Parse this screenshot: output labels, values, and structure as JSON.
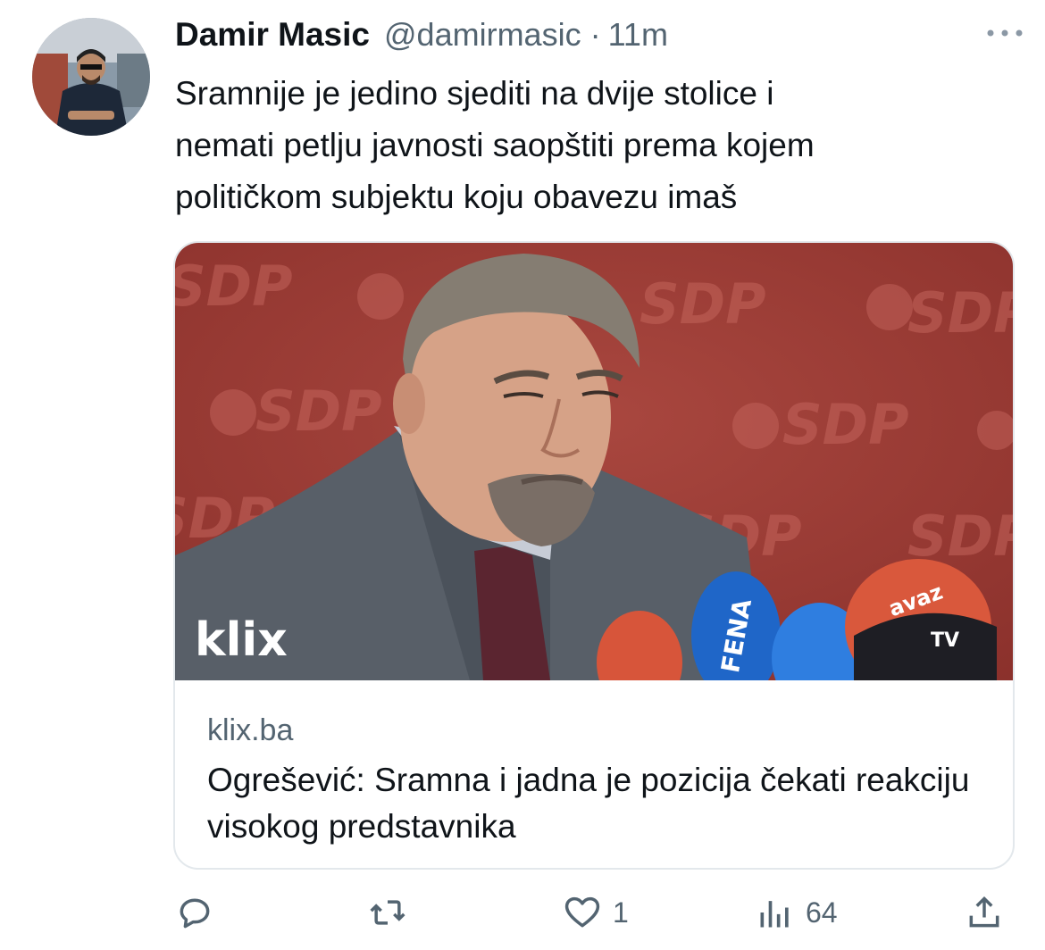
{
  "tweet": {
    "author_name": "Damir Masic",
    "author_handle": "@damirmasic",
    "separator": "·",
    "time": "11m",
    "text": "Sramnije je jedino sjediti na dvije stolice i\nnemati petlju javnosti saopštiti prema kojem\npolitičkom subjektu koju obavezu imaš"
  },
  "card": {
    "image_watermark": "klix",
    "backdrop_logo": "SDP",
    "mic_labels": [
      "FENA",
      "avaz",
      "TV"
    ],
    "domain": "klix.ba",
    "title": "Ogrešević: Sramna i jadna je pozicija čekati reakciju visokog predstavnika"
  },
  "actions": {
    "reply_icon": "reply-icon",
    "retweet_icon": "retweet-icon",
    "like_icon": "heart-icon",
    "like_count": "1",
    "views_icon": "views-icon",
    "views_count": "64",
    "share_icon": "share-icon"
  },
  "colors": {
    "text": "#0f1419",
    "secondary": "#536471",
    "border": "#e3e8ec",
    "backdrop_red": "#9c3a33"
  }
}
